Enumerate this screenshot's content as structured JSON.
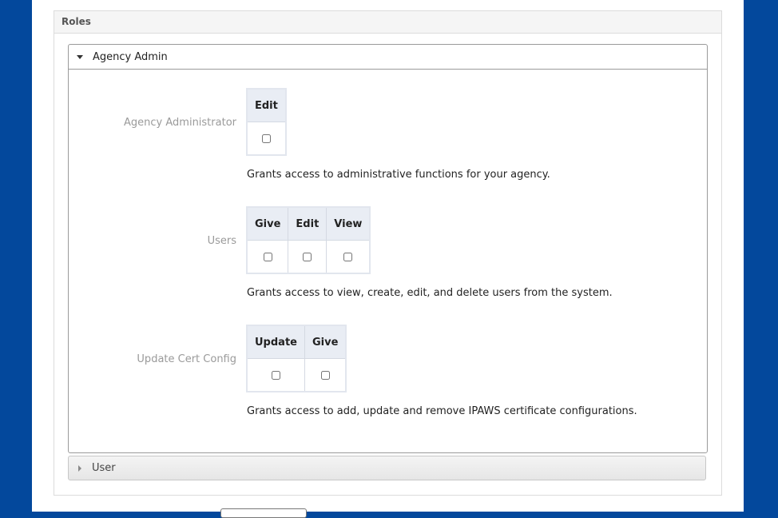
{
  "roles_panel": {
    "title": "Roles"
  },
  "agency_admin": {
    "title": "Agency Admin",
    "roles": [
      {
        "label": "Agency Administrator",
        "columns": [
          "Edit"
        ],
        "description": "Grants access to administrative functions for your agency."
      },
      {
        "label": "Users",
        "columns": [
          "Give",
          "Edit",
          "View"
        ],
        "description": "Grants access to view, create, edit, and delete users from the system."
      },
      {
        "label": "Update Cert Config",
        "columns": [
          "Update",
          "Give"
        ],
        "description": "Grants access to add, update and remove IPAWS certificate configurations."
      }
    ]
  },
  "user_section": {
    "title": "User"
  },
  "icons": {
    "expanded": "caret-down-icon",
    "collapsed": "caret-right-icon"
  },
  "colors": {
    "background": "#03489c",
    "header": "#f5f5f5",
    "table_header": "#e9edf4"
  }
}
